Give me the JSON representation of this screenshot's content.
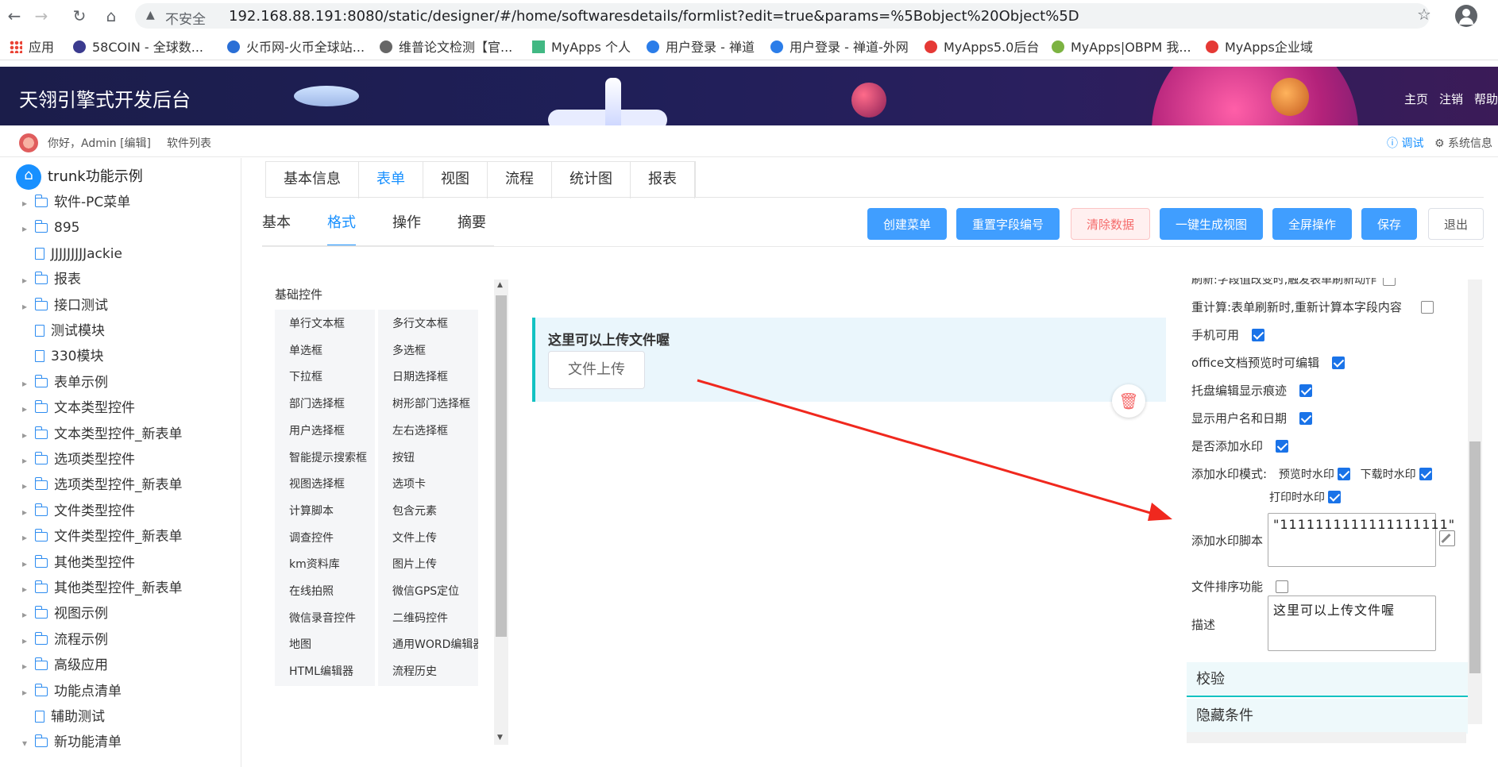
{
  "browser": {
    "security_label": "不安全",
    "url": "192.168.88.191:8080/static/designer/#/home/softwaresdetails/formlist?edit=true&params=%5Bobject%20Object%5D",
    "bookmarks": [
      "应用",
      "58COIN - 全球数...",
      "火币网-火币全球站...",
      "维普论文检测【官...",
      "MyApps 个人",
      "用户登录 - 禅道",
      "用户登录 - 禅道-外网",
      "MyApps5.0后台",
      "MyApps|OBPM 我...",
      "MyApps企业域"
    ]
  },
  "header": {
    "title": "天翎引擎式开发后台",
    "links": [
      "主页",
      "注销",
      "帮助"
    ]
  },
  "userbar": {
    "greeting": "你好，Admin [编辑]",
    "software_list": "软件列表",
    "debug": "调试",
    "system_info": "系统信息"
  },
  "sidebar": {
    "root": "trunk功能示例",
    "items": [
      {
        "label": "软件-PC菜单",
        "type": "folder"
      },
      {
        "label": "895",
        "type": "folder"
      },
      {
        "label": "JJJJJJJJJackie",
        "type": "doc"
      },
      {
        "label": "报表",
        "type": "folder"
      },
      {
        "label": "接口测试",
        "type": "folder"
      },
      {
        "label": "测试模块",
        "type": "doc"
      },
      {
        "label": "330模块",
        "type": "doc"
      },
      {
        "label": "表单示例",
        "type": "folder"
      },
      {
        "label": "文本类型控件",
        "type": "folder"
      },
      {
        "label": "文本类型控件_新表单",
        "type": "folder"
      },
      {
        "label": "选项类型控件",
        "type": "folder"
      },
      {
        "label": "选项类型控件_新表单",
        "type": "folder"
      },
      {
        "label": "文件类型控件",
        "type": "folder"
      },
      {
        "label": "文件类型控件_新表单",
        "type": "folder"
      },
      {
        "label": "其他类型控件",
        "type": "folder"
      },
      {
        "label": "其他类型控件_新表单",
        "type": "folder"
      },
      {
        "label": "视图示例",
        "type": "folder"
      },
      {
        "label": "流程示例",
        "type": "folder"
      },
      {
        "label": "高级应用",
        "type": "folder"
      },
      {
        "label": "功能点清单",
        "type": "folder"
      },
      {
        "label": "辅助测试",
        "type": "doc"
      },
      {
        "label": "新功能清单",
        "type": "folder-open"
      }
    ]
  },
  "main_tabs": [
    "基本信息",
    "表单",
    "视图",
    "流程",
    "统计图",
    "报表"
  ],
  "main_tab_active": "表单",
  "sub_tabs": [
    "基本",
    "格式",
    "操作",
    "摘要"
  ],
  "sub_tab_active": "格式",
  "toolbar": {
    "create_menu": "创建菜单",
    "reset_field_no": "重置字段编号",
    "clear_data": "清除数据",
    "gen_view": "一键生成视图",
    "fullscreen": "全屏操作",
    "save": "保存",
    "exit": "退出"
  },
  "palette": {
    "title": "基础控件",
    "controls": [
      "单行文本框",
      "多行文本框",
      "单选框",
      "多选框",
      "下拉框",
      "日期选择框",
      "部门选择框",
      "树形部门选择框",
      "用户选择框",
      "左右选择框",
      "智能提示搜索框",
      "按钮",
      "视图选择框",
      "选项卡",
      "计算脚本",
      "包含元素",
      "调查控件",
      "文件上传",
      "km资料库",
      "图片上传",
      "在线拍照",
      "微信GPS定位",
      "微信录音控件",
      "二维码控件",
      "地图",
      "通用WORD编辑器",
      "HTML编辑器",
      "流程历史"
    ]
  },
  "canvas": {
    "field_label": "这里可以上传文件喔",
    "upload_button": "文件上传"
  },
  "props": {
    "partial_top": "刷新:字段值改变时,触发表单刷新动作",
    "recalc": "重计算:表单刷新时,重新计算本字段内容",
    "mobile": "手机可用",
    "office_edit": "office文档预览时可编辑",
    "tray_trace": "托盘编辑显示痕迹",
    "show_user_date": "显示用户名和日期",
    "add_watermark": "是否添加水印",
    "watermark_mode": "添加水印模式:",
    "preview_wm": "预览时水印",
    "download_wm": "下载时水印",
    "print_wm": "打印时水印",
    "wm_script_label": "添加水印脚本",
    "wm_script_value": "\"1111111111111111111\"",
    "file_sort": "文件排序功能",
    "desc_label": "描述",
    "desc_value": "这里可以上传文件喔",
    "section_validate": "校验",
    "section_hidden": "隐藏条件"
  }
}
